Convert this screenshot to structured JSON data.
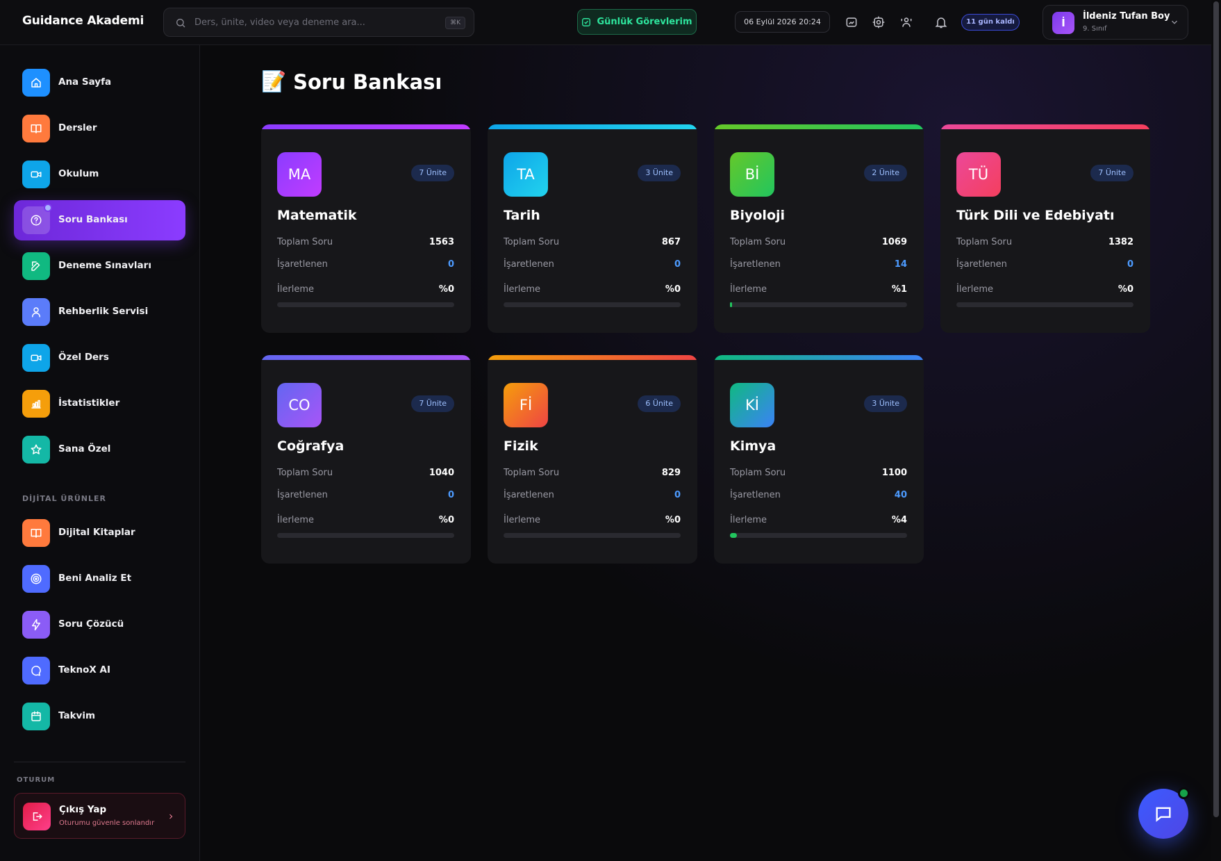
{
  "app": {
    "brand": "Guidance Akademi"
  },
  "header": {
    "search_placeholder": "Ders, ünite, video veya deneme ara...",
    "search_shortcut": "⌘K",
    "tasks_label": "Günlük Görevlerim",
    "datetime": "06 Eylül 2026 20:24",
    "days_left": "11 gün kaldı",
    "user": {
      "initial": "İ",
      "name": "İldeniz Tufan Boy",
      "grade": "9. Sınıf"
    }
  },
  "sidebar": {
    "items": [
      {
        "label": "Ana Sayfa",
        "icon": "home-icon",
        "color": "#1e90ff"
      },
      {
        "label": "Dersler",
        "icon": "book-icon",
        "color": "#ff7a3d"
      },
      {
        "label": "Okulum",
        "icon": "video-icon",
        "color": "#0ea5e9"
      },
      {
        "label": "Soru Bankası",
        "icon": "question-icon",
        "color": "#7c3aed",
        "active": true
      },
      {
        "label": "Deneme Sınavları",
        "icon": "edit-icon",
        "color": "#10b981"
      },
      {
        "label": "Rehberlik Servisi",
        "icon": "user-icon",
        "color": "#5b7cfa"
      },
      {
        "label": "Özel Ders",
        "icon": "video-icon",
        "color": "#0ea5e9"
      },
      {
        "label": "İstatistikler",
        "icon": "chart-icon",
        "color": "#f59e0b"
      },
      {
        "label": "Sana Özel",
        "icon": "star-icon",
        "color": "#14b8a6"
      }
    ],
    "digital_section_label": "DİJİTAL ÜRÜNLER",
    "digital_items": [
      {
        "label": "Dijital Kitaplar",
        "icon": "book-icon",
        "color": "#ff7a3d"
      },
      {
        "label": "Beni Analiz Et",
        "icon": "target-icon",
        "color": "#4f6bff"
      },
      {
        "label": "Soru Çözücü",
        "icon": "lightning-icon",
        "color": "#8b5cf6"
      },
      {
        "label": "TeknoX AI",
        "icon": "chat-bubble-icon",
        "color": "#4f6bff"
      },
      {
        "label": "Takvim",
        "icon": "calendar-icon",
        "color": "#14b8a6"
      }
    ],
    "session_label": "OTURUM",
    "logout": {
      "title": "Çıkış Yap",
      "subtitle": "Oturumu güvenle sonlandır"
    }
  },
  "main": {
    "title_emoji": "📝",
    "title": "Soru Bankası",
    "labels": {
      "total": "Toplam Soru",
      "marked": "İşaretlenen",
      "progress": "İlerleme"
    },
    "subjects": [
      {
        "abbr": "MA",
        "name": "Matematik",
        "units": "7 Ünite",
        "total": "1563",
        "marked": "0",
        "progress": "%0",
        "progress_value": 0,
        "gradient": [
          "#8b3cff",
          "#c13cff"
        ]
      },
      {
        "abbr": "TA",
        "name": "Tarih",
        "units": "3 Ünite",
        "total": "867",
        "marked": "0",
        "progress": "%0",
        "progress_value": 0,
        "gradient": [
          "#0ea5e9",
          "#22d3ee"
        ]
      },
      {
        "abbr": "Bİ",
        "name": "Biyoloji",
        "units": "2 Ünite",
        "total": "1069",
        "marked": "14",
        "progress": "%1",
        "progress_value": 1,
        "gradient": [
          "#65c82a",
          "#22c55e"
        ]
      },
      {
        "abbr": "TÜ",
        "name": "Türk Dili ve Edebiyatı",
        "units": "7 Ünite",
        "total": "1382",
        "marked": "0",
        "progress": "%0",
        "progress_value": 0,
        "gradient": [
          "#ec4899",
          "#f43f5e"
        ]
      },
      {
        "abbr": "CO",
        "name": "Coğrafya",
        "units": "7 Ünite",
        "total": "1040",
        "marked": "0",
        "progress": "%0",
        "progress_value": 0,
        "gradient": [
          "#6366f1",
          "#a855f7"
        ]
      },
      {
        "abbr": "Fİ",
        "name": "Fizik",
        "units": "6 Ünite",
        "total": "829",
        "marked": "0",
        "progress": "%0",
        "progress_value": 0,
        "gradient": [
          "#f59e0b",
          "#ef4444"
        ]
      },
      {
        "abbr": "Kİ",
        "name": "Kimya",
        "units": "3 Ünite",
        "total": "1100",
        "marked": "40",
        "progress": "%4",
        "progress_value": 4,
        "gradient": [
          "#10b981",
          "#3b82f6"
        ]
      }
    ]
  }
}
